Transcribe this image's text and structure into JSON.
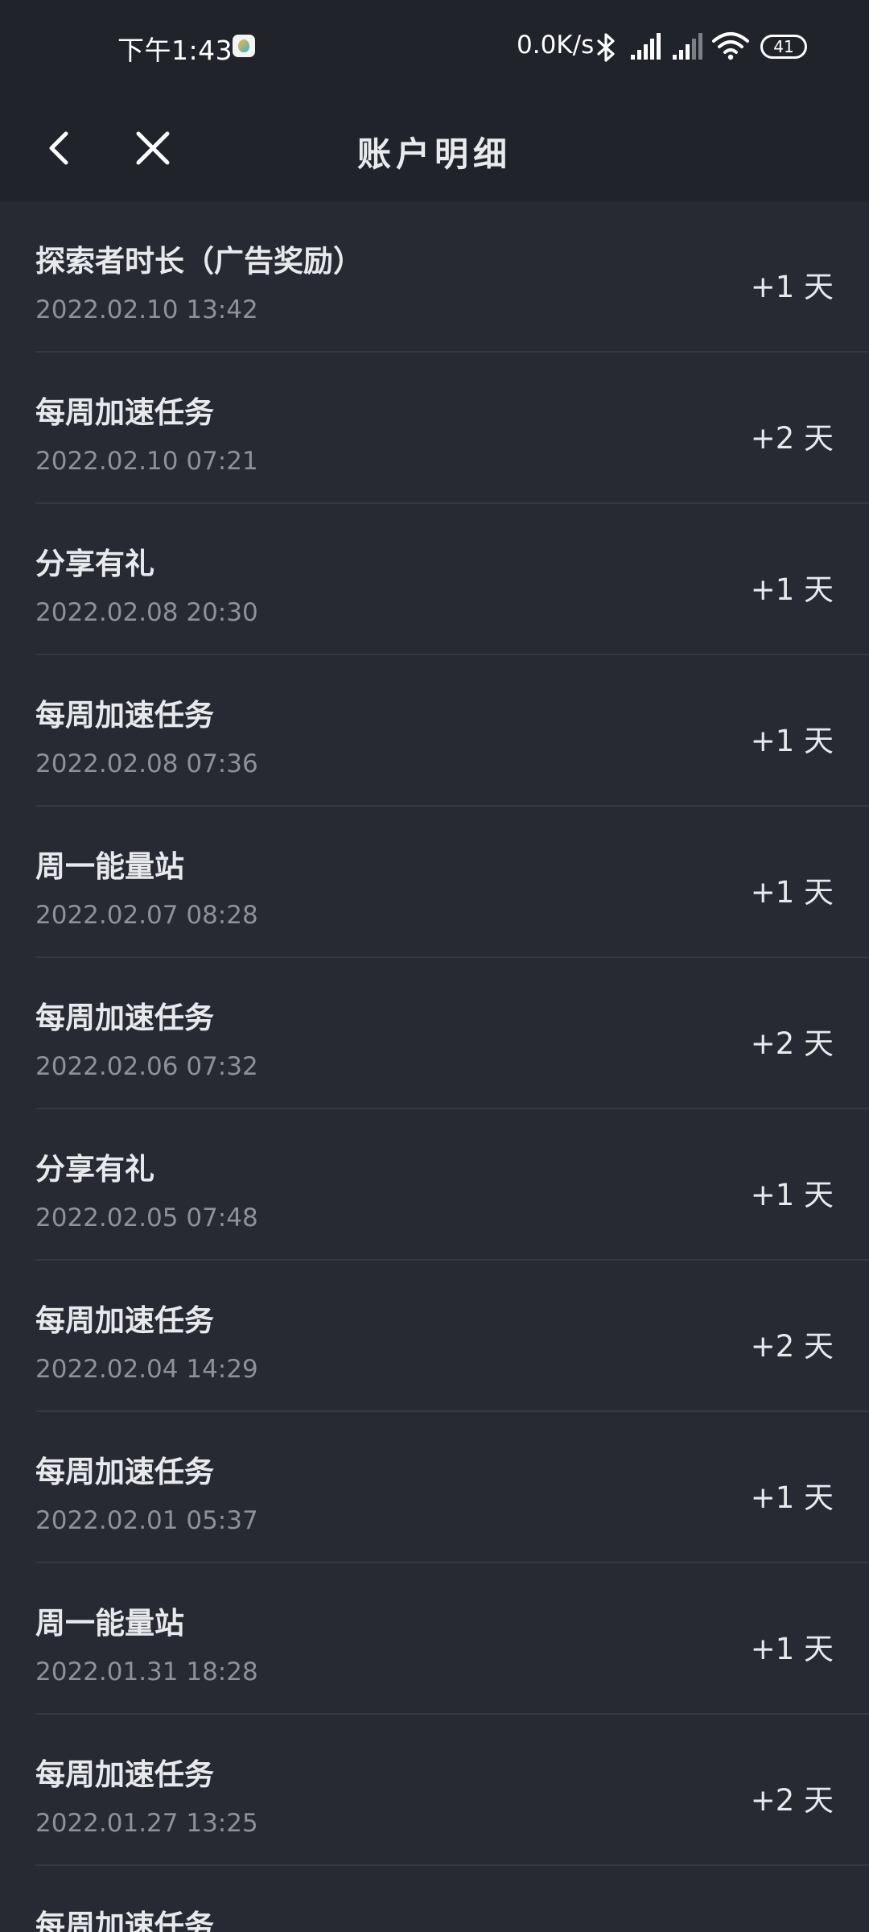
{
  "status_bar": {
    "time": "下午1:43",
    "app_icon": "app-notification-icon",
    "network_speed": "0.0K/s",
    "icons": [
      "bluetooth-icon",
      "signal-icon",
      "signal-icon",
      "wifi-icon"
    ],
    "battery": "41"
  },
  "header": {
    "title": "账户明细",
    "back_icon": "chevron-left-icon",
    "close_icon": "close-icon"
  },
  "transactions": [
    {
      "title": "探索者时长（广告奖励）",
      "time": "2022.02.10 13:42",
      "amount": "+1 天"
    },
    {
      "title": "每周加速任务",
      "time": "2022.02.10 07:21",
      "amount": "+2 天"
    },
    {
      "title": "分享有礼",
      "time": "2022.02.08 20:30",
      "amount": "+1 天"
    },
    {
      "title": "每周加速任务",
      "time": "2022.02.08 07:36",
      "amount": "+1 天"
    },
    {
      "title": "周一能量站",
      "time": "2022.02.07 08:28",
      "amount": "+1 天"
    },
    {
      "title": "每周加速任务",
      "time": "2022.02.06 07:32",
      "amount": "+2 天"
    },
    {
      "title": "分享有礼",
      "time": "2022.02.05 07:48",
      "amount": "+1 天"
    },
    {
      "title": "每周加速任务",
      "time": "2022.02.04 14:29",
      "amount": "+2 天"
    },
    {
      "title": "每周加速任务",
      "time": "2022.02.01 05:37",
      "amount": "+1 天"
    },
    {
      "title": "周一能量站",
      "time": "2022.01.31 18:28",
      "amount": "+1 天"
    },
    {
      "title": "每周加速任务",
      "time": "2022.01.27 13:25",
      "amount": "+2 天"
    },
    {
      "title": "每周加速任务",
      "time": "",
      "amount": ""
    }
  ]
}
